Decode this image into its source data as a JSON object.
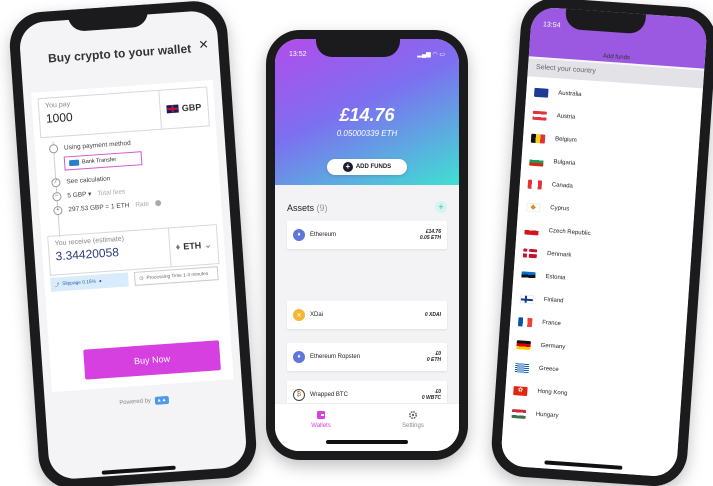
{
  "buy": {
    "title": "Buy crypto to your wallet",
    "close": "×",
    "pay_label": "You pay",
    "pay_value": "1000",
    "pay_currency": "GBP",
    "method_label": "Using payment method",
    "method_value": "Bank Transfer",
    "see_calc": "See calculation",
    "fees_value": "5 GBP ▾",
    "fees_label": "Total fees",
    "rate_value": "297.53 GBP = 1 ETH",
    "rate_label": "Rate",
    "receive_label": "You receive (estimate)",
    "receive_value": "3.34420058",
    "receive_currency": "ETH",
    "slippage": "Slippage 0.15%",
    "processing": "Processing Time 1-3 minutes",
    "buy_button": "Buy Now",
    "powered_by": "Powered by"
  },
  "wallet": {
    "time": "13:52",
    "balance": "£14.76",
    "balance_eth": "0.05000339 ETH",
    "add_funds": "ADD FUNDS",
    "assets_title": "Assets",
    "assets_count": "(9)",
    "assets": [
      {
        "name": "Ethereum",
        "amount_fiat": "£14.76",
        "amount_crypto": "0.05 ETH",
        "icon": "eth-icon"
      },
      {
        "name": "XDai",
        "amount_fiat": "",
        "amount_crypto": "0 XDAI",
        "icon": "xdai-icon"
      },
      {
        "name": "Ethereum Ropsten",
        "amount_fiat": "£0",
        "amount_crypto": "0 ETH",
        "icon": "eth-icon"
      },
      {
        "name": "Wrapped BTC",
        "amount_fiat": "£0",
        "amount_crypto": "0 WBTC",
        "icon": "wbtc-icon"
      }
    ],
    "tabs": [
      {
        "label": "Wallets",
        "icon": "wallet-icon",
        "active": true
      },
      {
        "label": "Settings",
        "icon": "gear-icon",
        "active": false
      }
    ],
    "colors": {
      "accent": "#d63fe0",
      "gradient_start": "#b24dea",
      "gradient_end": "#3fe0d2"
    }
  },
  "countries": {
    "time": "13:54",
    "title": "Add funds",
    "header": "Select your country",
    "items": [
      "Australia",
      "Austria",
      "Belgium",
      "Bulgaria",
      "Canada",
      "Cyprus",
      "Czech Republic",
      "Denmark",
      "Estonia",
      "Finland",
      "France",
      "Germany",
      "Greece",
      "Hong Kong",
      "Hungary"
    ]
  }
}
